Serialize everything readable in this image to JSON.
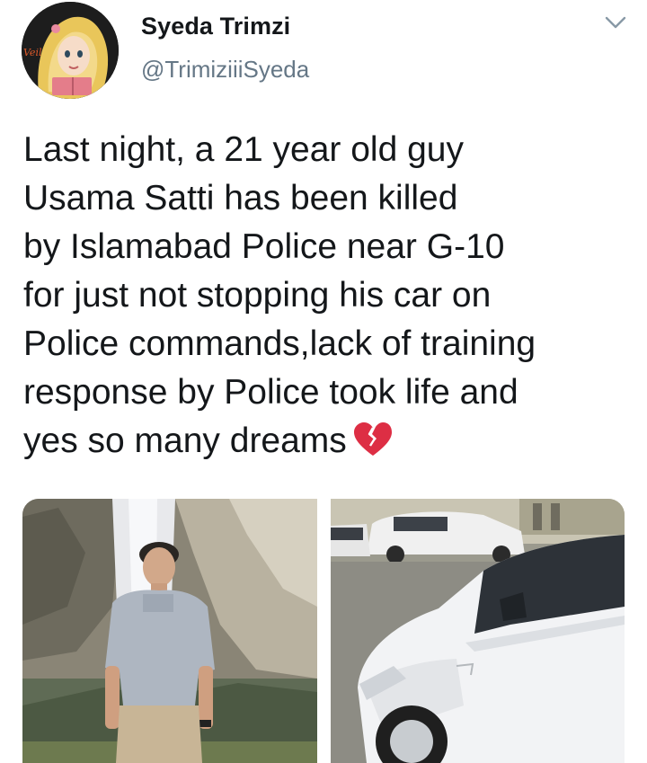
{
  "tweet": {
    "author": {
      "display_name": "Syeda Trimzi",
      "handle": "@TrimiziiiSyeda",
      "avatar_badge": "Veil"
    },
    "menu_icon": "chevron-down-icon",
    "text_lines": [
      "Last night, a 21 year old guy",
      "Usama Satti has been killed",
      "by Islamabad Police near G-10",
      "for just not stopping his car on",
      "Police commands,lack of training",
      "response by Police took life and",
      "yes so many dreams"
    ],
    "emoji": "broken-heart-icon",
    "media": [
      {
        "name": "photo-young-man-waterfall"
      },
      {
        "name": "photo-damaged-white-car"
      }
    ]
  },
  "colors": {
    "text": "#14171a",
    "secondary": "#657786",
    "emoji_red": "#dd2e44"
  }
}
